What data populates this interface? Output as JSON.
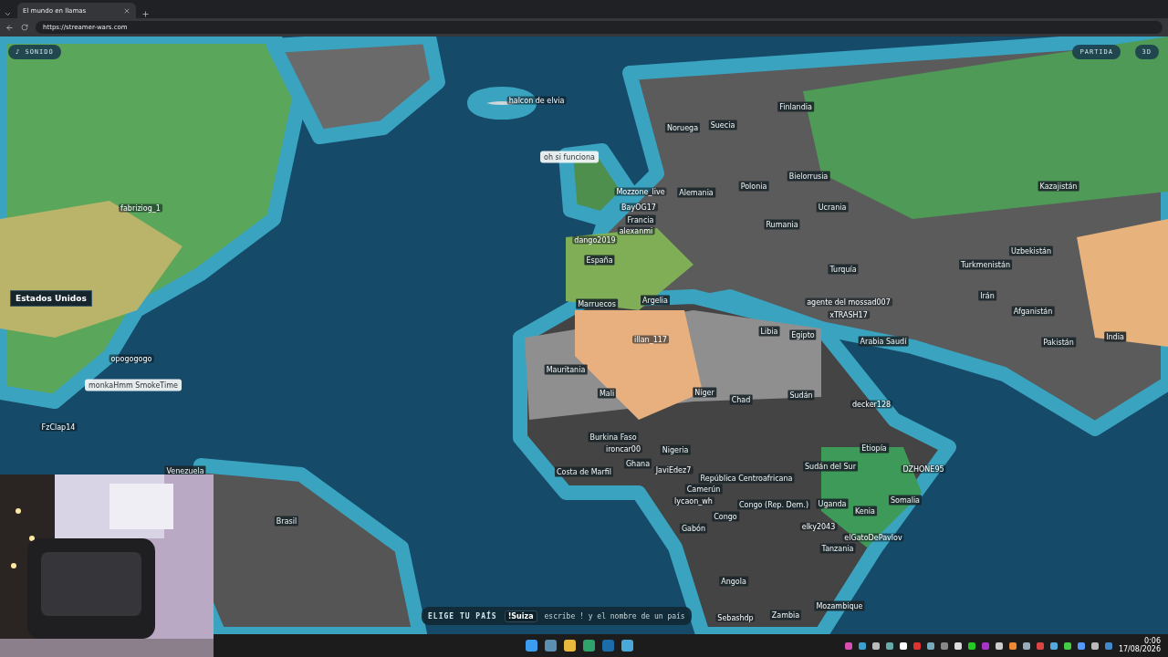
{
  "browser": {
    "tab_title": "El mundo en llamas",
    "url": "https://streamer-wars.com"
  },
  "game": {
    "sound_button": "♪ SONIDO",
    "match_button": "PARTIDA",
    "view_button": "3D",
    "hover_label": "Estados Unidos",
    "countries": [
      {
        "label": "Finlandia"
      },
      {
        "label": "Noruega"
      },
      {
        "label": "Suecia"
      },
      {
        "label": "Alemania"
      },
      {
        "label": "Polonia"
      },
      {
        "label": "Bielorrusia"
      },
      {
        "label": "Ucrania"
      },
      {
        "label": "Rumania"
      },
      {
        "label": "Francia"
      },
      {
        "label": "España"
      },
      {
        "label": "Turquía"
      },
      {
        "label": "Marruecos"
      },
      {
        "label": "Argelia"
      },
      {
        "label": "Libia"
      },
      {
        "label": "Egipto"
      },
      {
        "label": "Arabia Saudí"
      },
      {
        "label": "Mauritania"
      },
      {
        "label": "Mali"
      },
      {
        "label": "Níger"
      },
      {
        "label": "Chad"
      },
      {
        "label": "Sudán"
      },
      {
        "label": "Burkina Faso"
      },
      {
        "label": "Costa de Marfil"
      },
      {
        "label": "Ghana"
      },
      {
        "label": "Nigeria"
      },
      {
        "label": "República Centroafricana"
      },
      {
        "label": "Sudán del Sur"
      },
      {
        "label": "Etiopía"
      },
      {
        "label": "Camerún"
      },
      {
        "label": "Congo (Rep. Dem.)"
      },
      {
        "label": "Congo"
      },
      {
        "label": "Gabón"
      },
      {
        "label": "Uganda"
      },
      {
        "label": "Kenia"
      },
      {
        "label": "Somalia"
      },
      {
        "label": "Tanzania"
      },
      {
        "label": "Angola"
      },
      {
        "label": "Zambia"
      },
      {
        "label": "Mozambique"
      },
      {
        "label": "Kazajistán"
      },
      {
        "label": "Turkmenistán"
      },
      {
        "label": "Uzbekistán"
      },
      {
        "label": "Irán"
      },
      {
        "label": "Afganistán"
      },
      {
        "label": "Pakistán"
      },
      {
        "label": "India"
      },
      {
        "label": "Venezuela"
      },
      {
        "label": "Brasil"
      }
    ],
    "players": [
      {
        "name": "halcon de elvia"
      },
      {
        "name": "fabriziog_1"
      },
      {
        "name": "Mozzone_live"
      },
      {
        "name": "BayOG17"
      },
      {
        "name": "alexanmi"
      },
      {
        "name": "dango2019"
      },
      {
        "name": "illan_117"
      },
      {
        "name": "agente del mossad007"
      },
      {
        "name": "xTRASH17"
      },
      {
        "name": "decker128"
      },
      {
        "name": "ironcar00"
      },
      {
        "name": "JaviEdez7"
      },
      {
        "name": "lycaon_wh"
      },
      {
        "name": "elky2043"
      },
      {
        "name": "elGatoDePavlov"
      },
      {
        "name": "DZHONE95"
      },
      {
        "name": "opogogogo"
      },
      {
        "name": "FzClap14"
      },
      {
        "name": "Sebashdp"
      }
    ],
    "chat_bubbles": [
      {
        "text": "oh si funciona"
      },
      {
        "text": "monkaHmm SmokeTime"
      }
    ],
    "command_bar": {
      "label": "ELIGE TU PAÍS",
      "example": "!Suiza",
      "hint": "escribe ! y el nombre de un país"
    }
  },
  "taskbar": {
    "time": "0:06",
    "date": "17/08/2026"
  }
}
